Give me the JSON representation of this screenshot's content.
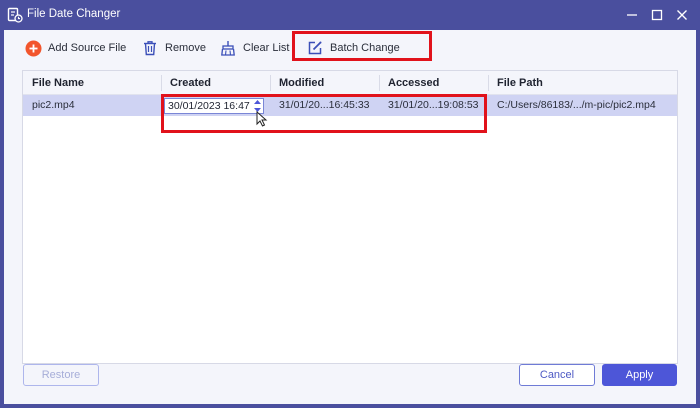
{
  "window": {
    "title": "File Date Changer"
  },
  "toolbar": {
    "add_source_label": "Add Source File",
    "remove_label": "Remove",
    "clear_list_label": "Clear List",
    "batch_change_label": "Batch Change"
  },
  "table": {
    "columns": [
      "File Name",
      "Created",
      "Modified",
      "Accessed",
      "File Path"
    ],
    "rows": [
      {
        "file_name": "pic2.mp4",
        "created": "30/01/2023 16:47",
        "modified": "31/01/20...16:45:33",
        "accessed": "31/01/20...19:08:53",
        "file_path": "C:/Users/86183/.../m-pic/pic2.mp4"
      }
    ]
  },
  "footer": {
    "restore_label": "Restore",
    "cancel_label": "Cancel",
    "apply_label": "Apply"
  },
  "colors": {
    "titlebar": "#4a4f9e",
    "accent": "#4d56d8",
    "highlight": "#e1121b",
    "selected_row": "#cfd3f3",
    "add_icon": "#f2552c"
  },
  "icons": {
    "app": "file-date-icon",
    "add": "plus-circle-icon",
    "remove": "trash-icon",
    "clear": "broom-icon",
    "batch": "edit-box-icon"
  }
}
